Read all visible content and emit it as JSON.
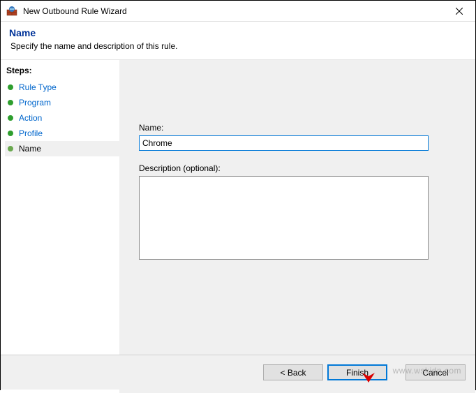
{
  "window": {
    "title": "New Outbound Rule Wizard"
  },
  "header": {
    "title": "Name",
    "subtitle": "Specify the name and description of this rule."
  },
  "sidebar": {
    "steps_label": "Steps:",
    "items": [
      {
        "label": "Rule Type",
        "state": "completed"
      },
      {
        "label": "Program",
        "state": "completed"
      },
      {
        "label": "Action",
        "state": "completed"
      },
      {
        "label": "Profile",
        "state": "completed"
      },
      {
        "label": "Name",
        "state": "current"
      }
    ]
  },
  "form": {
    "name_label": "Name:",
    "name_value": "Chrome",
    "desc_label": "Description (optional):",
    "desc_value": ""
  },
  "buttons": {
    "back": "< Back",
    "finish": "Finish",
    "cancel": "Cancel"
  },
  "watermark": "www.wskidn.com"
}
